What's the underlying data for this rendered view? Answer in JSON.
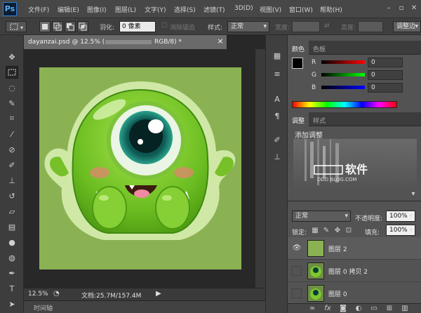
{
  "app": {
    "logo": "Ps",
    "menus": [
      "文件(F)",
      "编辑(E)",
      "图像(I)",
      "图层(L)",
      "文字(Y)",
      "选择(S)",
      "滤镜(T)",
      "3D(D)",
      "视图(V)",
      "窗口(W)",
      "帮助(H)"
    ]
  },
  "window_controls": {
    "minimize": "–",
    "restore": "▫",
    "close": "✕"
  },
  "options": {
    "feather_label": "羽化:",
    "feather_value": "0 像素",
    "antialias_label": "消除锯齿",
    "style_label": "样式:",
    "style_value": "正常",
    "width_label": "宽度:",
    "height_label": "高度:",
    "refine_edge_label": "调整边"
  },
  "document": {
    "tab_title": "dayanzai.psd @ 12.5% (",
    "tab_suffix": "RGB/8) *",
    "close": "×",
    "zoom": "12.5%",
    "doc_info": "文档:25.7M/157.4M",
    "timeline_label": "时间轴"
  },
  "color_panel": {
    "tabs": [
      "颜色",
      "色板"
    ],
    "channels": [
      {
        "label": "R",
        "value": "0"
      },
      {
        "label": "G",
        "value": "0"
      },
      {
        "label": "B",
        "value": "0"
      }
    ]
  },
  "adjust_panel": {
    "tabs": [
      "调整",
      "样式"
    ],
    "add_label": "添加调整",
    "watermark_brand": "软件",
    "watermark_url": "DDD BLOG.COM"
  },
  "layers_panel": {
    "blend_mode": "正常",
    "opacity_label": "不透明度:",
    "opacity_value": "100%",
    "lock_label": "锁定:",
    "fill_label": "填充:",
    "fill_value": "100%",
    "layers": [
      {
        "name": "图层 2",
        "visible": true
      },
      {
        "name": "图层 0 拷贝 2",
        "visible": false
      },
      {
        "name": "图层 0",
        "visible": false
      }
    ],
    "bottom_icons": [
      "link-icon",
      "fx-icon",
      "mask-icon",
      "adjustment-icon",
      "folder-icon",
      "new-layer-icon",
      "trash-icon"
    ]
  },
  "colors": {
    "accent": "#8ab253",
    "monster": "#7ec72e"
  }
}
